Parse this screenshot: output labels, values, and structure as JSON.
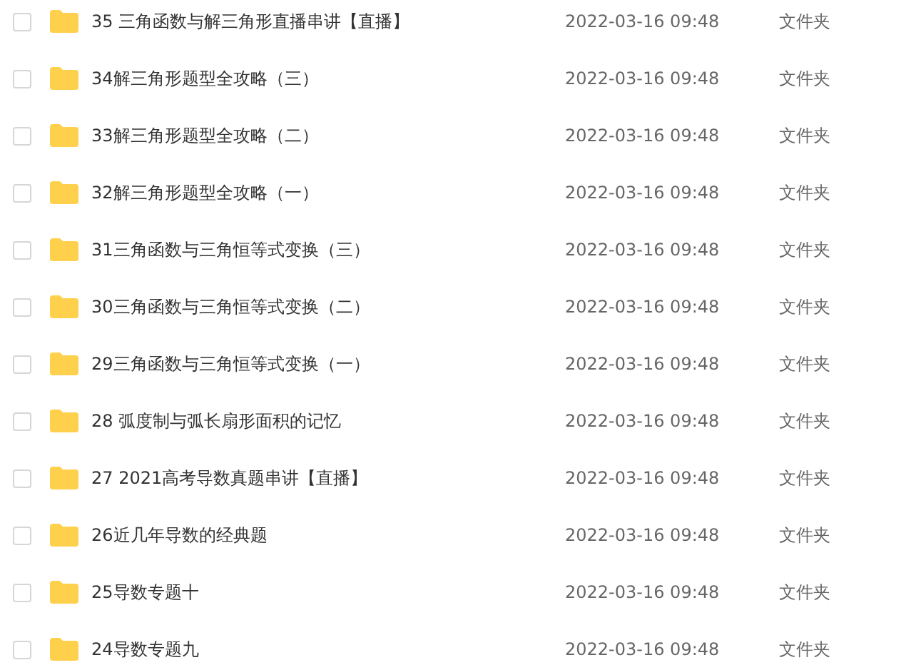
{
  "files": [
    {
      "name": "35 三角函数与解三角形直播串讲【直播】",
      "modified": "2022-03-16 09:48",
      "type": "文件夹",
      "selected": false
    },
    {
      "name": "34解三角形题型全攻略（三）",
      "modified": "2022-03-16 09:48",
      "type": "文件夹",
      "selected": false
    },
    {
      "name": "33解三角形题型全攻略（二）",
      "modified": "2022-03-16 09:48",
      "type": "文件夹",
      "selected": false
    },
    {
      "name": "32解三角形题型全攻略（一）",
      "modified": "2022-03-16 09:48",
      "type": "文件夹",
      "selected": false
    },
    {
      "name": "31三角函数与三角恒等式变换（三）",
      "modified": "2022-03-16 09:48",
      "type": "文件夹",
      "selected": false
    },
    {
      "name": "30三角函数与三角恒等式变换（二）",
      "modified": "2022-03-16 09:48",
      "type": "文件夹",
      "selected": false
    },
    {
      "name": "29三角函数与三角恒等式变换（一）",
      "modified": "2022-03-16 09:48",
      "type": "文件夹",
      "selected": false
    },
    {
      "name": "28 弧度制与弧长扇形面积的记忆",
      "modified": "2022-03-16 09:48",
      "type": "文件夹",
      "selected": false
    },
    {
      "name": "27 2021高考导数真题串讲【直播】",
      "modified": "2022-03-16 09:48",
      "type": "文件夹",
      "selected": false
    },
    {
      "name": "26近几年导数的经典题",
      "modified": "2022-03-16 09:48",
      "type": "文件夹",
      "selected": false
    },
    {
      "name": "25导数专题十",
      "modified": "2022-03-16 09:48",
      "type": "文件夹",
      "selected": false
    },
    {
      "name": "24导数专题九",
      "modified": "2022-03-16 09:48",
      "type": "文件夹",
      "selected": false
    }
  ]
}
